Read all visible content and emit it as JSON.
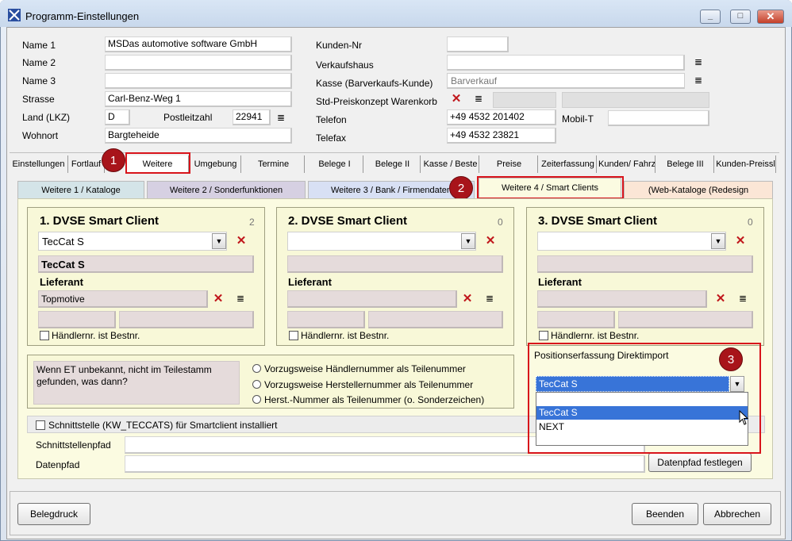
{
  "window": {
    "title": "Programm-Einstellungen",
    "min": "_",
    "max": "□",
    "close": "✕"
  },
  "company": {
    "name1_label": "Name 1",
    "name1": "MSDas automotive software GmbH",
    "name2_label": "Name 2",
    "name2": "",
    "name3_label": "Name 3",
    "name3": "",
    "street_label": "Strasse",
    "street": "Carl-Benz-Weg 1",
    "country_label": "Land (LKZ)",
    "country": "D",
    "zip_label": "Postleitzahl",
    "zip": "22941",
    "city_label": "Wohnort",
    "city": "Bargteheide"
  },
  "customer": {
    "kundennr_label": "Kunden-Nr",
    "kundennr": "",
    "verkaufshaus_label": "Verkaufshaus",
    "verkaufshaus": "",
    "kasse_label": "Kasse (Barverkaufs-Kunde)",
    "kasse": "Barverkauf",
    "preis_label": "Std-Preiskonzept Warenkorb",
    "telefon_label": "Telefon",
    "telefon": "+49 4532 201402",
    "mobil_label": "Mobil-T",
    "mobil": "",
    "telefax_label": "Telefax",
    "telefax": "+49 4532 23821"
  },
  "tabs_main": [
    "Einstellungen",
    "Fortlauf",
    "",
    "Weitere",
    "Umgebung",
    "Termine",
    "Belege I",
    "Belege II",
    "Kasse / Beste",
    "Preise",
    "Zeiterfassung",
    "Kunden/ Fahrz",
    "Belege III",
    "Kunden-Preissl"
  ],
  "tabs_sub": [
    "Weitere 1 / Kataloge",
    "Weitere 2 / Sonderfunktionen",
    "Weitere 3 / Bank / Firmendaten",
    "Weitere 4 / Smart Clients",
    "(Web-Kataloge (Redesign"
  ],
  "badges": [
    "1",
    "2",
    "3"
  ],
  "clients": [
    {
      "title": "1. DVSE Smart Client",
      "count": "2",
      "combo": "TecCat S",
      "name": "TecCat S",
      "lieferant_label": "Lieferant",
      "lieferant": "Topmotive",
      "haendler_label": "Händlernr. ist Bestnr."
    },
    {
      "title": "2. DVSE Smart Client",
      "count": "0",
      "combo": "",
      "name": "",
      "lieferant_label": "Lieferant",
      "lieferant": "",
      "haendler_label": "Händlernr. ist Bestnr."
    },
    {
      "title": "3. DVSE Smart Client",
      "count": "0",
      "combo": "",
      "name": "",
      "lieferant_label": "Lieferant",
      "lieferant": "",
      "haendler_label": "Händlernr. ist Bestnr."
    }
  ],
  "unknown": {
    "question": "Wenn  ET unbekannt, nicht im Teilestamm gefunden, was dann?",
    "options": [
      "Vorzugsweise Händlernummer als Teilenummer",
      "Vorzugsweise Herstellernummer als Teilenummer",
      "Herst.-Nummer als Teilenummer (o. Sonderzeichen)"
    ]
  },
  "direktimport": {
    "label": "Positionserfassung Direktimport",
    "selected": "TecCat S",
    "options": [
      "TecCat S",
      "NEXT"
    ]
  },
  "schnittstelle": {
    "checkbox_label": "Schnittstelle (KW_TECCATS) für Smartclient installiert",
    "pfad_label": "Schnittstellenpfad",
    "pfad": "",
    "daten_label": "Datenpfad",
    "daten": "",
    "datenpfad_button": "Datenpfad festlegen"
  },
  "footer": {
    "belegdruck": "Belegdruck",
    "beenden": "Beenden",
    "abbrechen": "Abbrechen"
  }
}
